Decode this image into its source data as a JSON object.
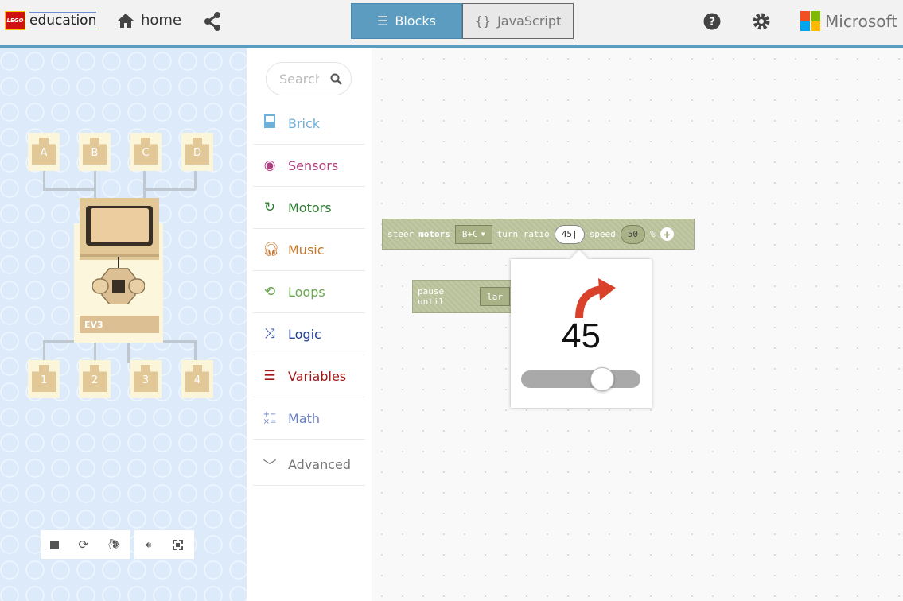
{
  "header": {
    "logo_badge": "LEGO",
    "logo_text": "education",
    "home_label": "home",
    "share_icon": "share-icon",
    "tabs": [
      {
        "label": "Blocks",
        "icon": "list-icon",
        "active": true
      },
      {
        "label": "JavaScript",
        "icon": "{}",
        "active": false
      }
    ],
    "help_icon": "question-icon",
    "settings_icon": "gear-icon",
    "brand": "Microsoft",
    "accent": "#5b9cc2"
  },
  "simulator": {
    "output_ports": [
      "A",
      "B",
      "C",
      "D"
    ],
    "input_ports": [
      "1",
      "2",
      "3",
      "4"
    ],
    "brick_label": "EV3",
    "controls": [
      "stop-icon",
      "restart-icon",
      "slow-mo-icon",
      "mute-icon",
      "fullscreen-icon"
    ]
  },
  "toolbox": {
    "search_placeholder": "Search",
    "categories": [
      {
        "label": "Brick",
        "color": "#6fb0d8",
        "icon": "brick-icon"
      },
      {
        "label": "Sensors",
        "color": "#b1407f",
        "icon": "target-icon"
      },
      {
        "label": "Motors",
        "color": "#2e7d32",
        "icon": "refresh-icon"
      },
      {
        "label": "Music",
        "color": "#c9772a",
        "icon": "headphones-icon"
      },
      {
        "label": "Loops",
        "color": "#6aa84f",
        "icon": "loop-icon"
      },
      {
        "label": "Logic",
        "color": "#23409a",
        "icon": "shuffle-icon"
      },
      {
        "label": "Variables",
        "color": "#a01818",
        "icon": "list-icon"
      },
      {
        "label": "Math",
        "color": "#6a80c0",
        "icon": "math-icon"
      },
      {
        "label": "Advanced",
        "color": "#777777",
        "icon": "chevron-down-icon"
      }
    ]
  },
  "workspace": {
    "steer_block": {
      "text1": "steer",
      "text2": "motors",
      "ports": "B+C",
      "text3": "turn ratio",
      "turn_ratio": "45",
      "text4": "speed",
      "speed": "50",
      "unit": "%"
    },
    "pause_block": {
      "text": "pause until",
      "dropdown": "lar"
    },
    "turn_popup": {
      "value": "45",
      "slider_min": -100,
      "slider_max": 100,
      "slider_value": 45
    }
  }
}
